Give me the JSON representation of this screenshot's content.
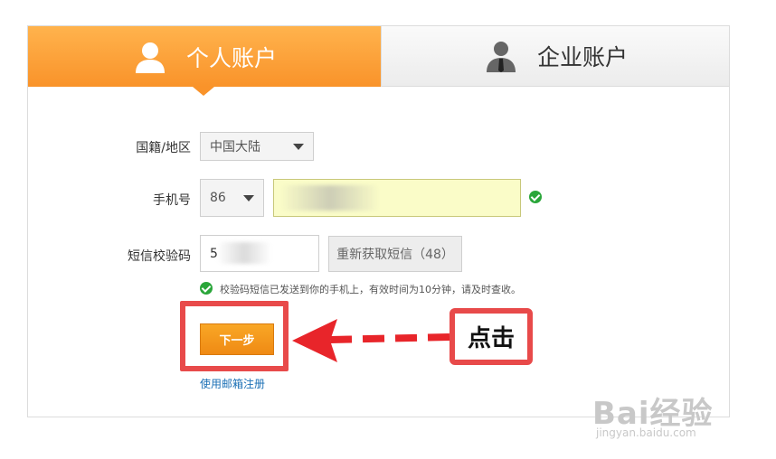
{
  "tabs": {
    "personal": {
      "label": "个人账户",
      "icon": "person-icon",
      "active": true
    },
    "enterprise": {
      "label": "企业账户",
      "icon": "business-person-icon",
      "active": false
    }
  },
  "form": {
    "region": {
      "label": "国籍/地区",
      "value": "中国大陆"
    },
    "phone": {
      "label": "手机号",
      "country_code": "86",
      "value": ""
    },
    "sms": {
      "label": "短信校验码",
      "value": "5",
      "resend_button": "重新获取短信（48）"
    },
    "notice": "校验码短信已发送到你的手机上，有效时间为10分钟，请及时查收。",
    "next_button": "下一步",
    "email_register_link": "使用邮箱注册"
  },
  "annotation": {
    "click_label": "点击"
  },
  "watermark": {
    "brand": "Bai经验",
    "url": "jingyan.baidu.com"
  },
  "colors": {
    "accent": "#f9932a",
    "highlight": "#e84a4a",
    "success": "#2aa63a",
    "link": "#1a6fb5"
  }
}
